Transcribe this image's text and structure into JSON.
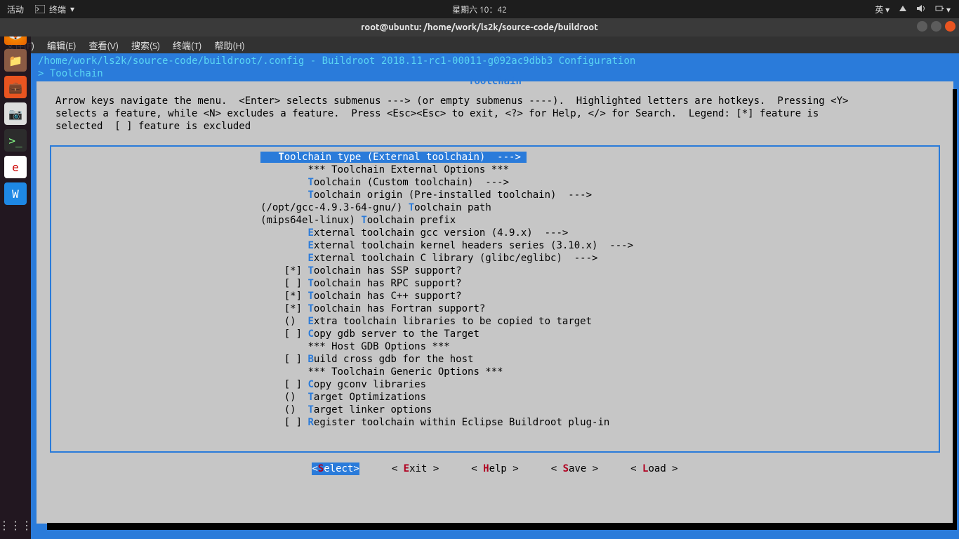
{
  "topbar": {
    "activities": "活动",
    "app": "终端",
    "clock": "星期六 10：42",
    "input": "英"
  },
  "titlebar": {
    "title": "root@ubuntu: /home/work/ls2k/source-code/buildroot"
  },
  "menubar": {
    "file": "文件(F)",
    "edit": "编辑(E)",
    "view": "查看(V)",
    "search": "搜索(S)",
    "terminal": "终端(T)",
    "help": "帮助(H)"
  },
  "config_header": {
    "path": "/home/work/ls2k/source-code/buildroot/.config - Buildroot 2018.11-rc1-00011-g092ac9dbb3 Configuration",
    "breadcrumb_prefix": "> ",
    "breadcrumb": "Toolchain"
  },
  "panel_title": "Toolchain",
  "help_lines": [
    "Arrow keys navigate the menu.  <Enter> selects submenus ---> (or empty submenus ----).  Highlighted letters are hotkeys.  Pressing <Y>",
    "selects a feature, while <N> excludes a feature.  Press <Esc><Esc> to exit, <?> for Help, </> for Search.  Legend: [*] feature is",
    "selected  [ ] feature is excluded"
  ],
  "items": [
    {
      "indent": "        ",
      "prefix": "",
      "hk": "T",
      "text": "oolchain type (External toolchain)  --->",
      "selected": true
    },
    {
      "indent": "        ",
      "prefix": "",
      "hk": "",
      "text": "*** Toolchain External Options ***"
    },
    {
      "indent": "        ",
      "prefix": "",
      "hk": "T",
      "text": "oolchain (Custom toolchain)  --->"
    },
    {
      "indent": "        ",
      "prefix": "",
      "hk": "T",
      "text": "oolchain origin (Pre-installed toolchain)  --->"
    },
    {
      "indent": "",
      "prefix": "(/opt/gcc-4.9.3-64-gnu/) ",
      "hk": "T",
      "text": "oolchain path"
    },
    {
      "indent": "",
      "prefix": "(mips64el-linux) ",
      "hk": "T",
      "text": "oolchain prefix"
    },
    {
      "indent": "        ",
      "prefix": "",
      "hk": "E",
      "text": "xternal toolchain gcc version (4.9.x)  --->"
    },
    {
      "indent": "        ",
      "prefix": "",
      "hk": "E",
      "text": "xternal toolchain kernel headers series (3.10.x)  --->"
    },
    {
      "indent": "        ",
      "prefix": "",
      "hk": "E",
      "text": "xternal toolchain C library (glibc/eglibc)  --->"
    },
    {
      "indent": "    ",
      "prefix": "[*] ",
      "hk": "T",
      "text": "oolchain has SSP support?"
    },
    {
      "indent": "    ",
      "prefix": "[ ] ",
      "hk": "T",
      "text": "oolchain has RPC support?"
    },
    {
      "indent": "    ",
      "prefix": "[*] ",
      "hk": "T",
      "text": "oolchain has C++ support?"
    },
    {
      "indent": "    ",
      "prefix": "[*] ",
      "hk": "T",
      "text": "oolchain has Fortran support?"
    },
    {
      "indent": "    ",
      "prefix": "()  ",
      "hk": "E",
      "text": "xtra toolchain libraries to be copied to target"
    },
    {
      "indent": "    ",
      "prefix": "[ ] ",
      "hk": "C",
      "text": "opy gdb server to the Target"
    },
    {
      "indent": "        ",
      "prefix": "",
      "hk": "",
      "text": "*** Host GDB Options ***"
    },
    {
      "indent": "    ",
      "prefix": "[ ] ",
      "hk": "B",
      "text": "uild cross gdb for the host"
    },
    {
      "indent": "        ",
      "prefix": "",
      "hk": "",
      "text": "*** Toolchain Generic Options ***"
    },
    {
      "indent": "    ",
      "prefix": "[ ] ",
      "hk": "C",
      "text": "opy gconv libraries"
    },
    {
      "indent": "    ",
      "prefix": "()  ",
      "hk": "T",
      "text": "arget Optimizations"
    },
    {
      "indent": "    ",
      "prefix": "()  ",
      "hk": "T",
      "text": "arget linker options"
    },
    {
      "indent": "    ",
      "prefix": "[ ] ",
      "hk": "R",
      "text": "egister toolchain within Eclipse Buildroot plug-in"
    }
  ],
  "buttons": {
    "select": {
      "pre": "<",
      "hk": "S",
      "rest": "elect>",
      "active": true
    },
    "exit": {
      "pre": "< ",
      "hk": "E",
      "rest": "xit >"
    },
    "help": {
      "pre": "< ",
      "hk": "H",
      "rest": "elp >"
    },
    "save": {
      "pre": "< ",
      "hk": "S",
      "rest": "ave >"
    },
    "load": {
      "pre": "< ",
      "hk": "L",
      "rest": "oad >"
    }
  }
}
